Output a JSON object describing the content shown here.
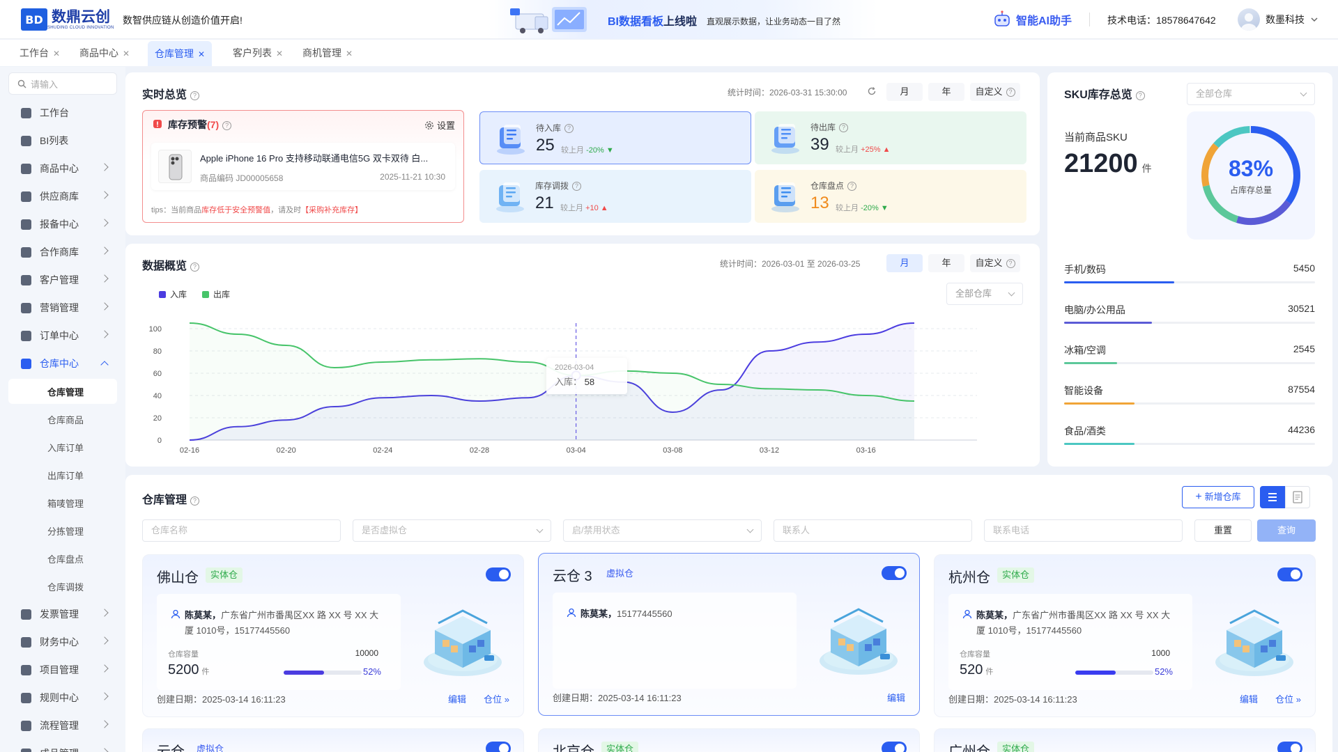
{
  "header": {
    "logo_mark": "BD",
    "logo_text": "数鼎云创",
    "logo_sub": "SHUDING CLOUD INNOVATION",
    "slogan": "数智供应链从创造价值开启!",
    "banner_title_a": "BI数据看板",
    "banner_title_b": "上线啦",
    "banner_desc": "直观展示数据，让业务动态一目了然",
    "ai_label": "智能AI助手",
    "phone": "技术电话：18578647642",
    "company": "数墨科技"
  },
  "tabs": [
    {
      "label": "工作台"
    },
    {
      "label": "商品中心"
    },
    {
      "label": "仓库管理",
      "active": true
    },
    {
      "label": "客户列表"
    },
    {
      "label": "商机管理"
    }
  ],
  "sidebar": {
    "search_placeholder": "请输入",
    "items": [
      {
        "label": "工作台",
        "chevron": false
      },
      {
        "label": "BI列表",
        "chevron": false
      },
      {
        "label": "商品中心",
        "chevron": true
      },
      {
        "label": "供应商库",
        "chevron": true
      },
      {
        "label": "报备中心",
        "chevron": true
      },
      {
        "label": "合作商库",
        "chevron": true
      },
      {
        "label": "客户管理",
        "chevron": true
      },
      {
        "label": "营销管理",
        "chevron": true
      },
      {
        "label": "订单中心",
        "chevron": true
      },
      {
        "label": "仓库中心",
        "chevron": true,
        "open": true
      }
    ],
    "subitems": [
      "仓库管理",
      "仓库商品",
      "入库订单",
      "出库订单",
      "箱唛管理",
      "分拣管理",
      "仓库盘点",
      "仓库调拨"
    ],
    "items_after": [
      {
        "label": "发票管理"
      },
      {
        "label": "财务中心"
      },
      {
        "label": "项目管理"
      },
      {
        "label": "规则中心"
      },
      {
        "label": "流程管理"
      },
      {
        "label": "成品管理"
      }
    ]
  },
  "realtime": {
    "title": "实时总览",
    "stat_time": "统计时间：2026-03-31 15:30:00",
    "periods": [
      "月",
      "年",
      "自定义"
    ],
    "warning": {
      "title": "库存预警",
      "count": "(7)",
      "settings": "设置",
      "product": "Apple iPhone 16 Pro 支持移动联通电信5G 双卡双待 白...",
      "code": "商品编码  JD00005658",
      "date": "2025-11-21  10:30",
      "tips_a": "tips：当前商品",
      "tips_b": "库存低于安全预警值",
      "tips_c": "，请及时",
      "tips_d": "【采购补充库存】"
    },
    "stats": [
      {
        "label": "待入库",
        "value": "25",
        "compare": "较上月",
        "change": "-20%",
        "dir": "down",
        "bg": "#e6eeff",
        "border": "#6b8df6",
        "accent": "#3d7bf5"
      },
      {
        "label": "待出库",
        "value": "39",
        "compare": "较上月",
        "change": "+25%",
        "dir": "up",
        "bg": "#e9f7ef",
        "border": "transparent",
        "accent": "#4e8ff7"
      },
      {
        "label": "库存调拨",
        "value": "21",
        "compare": "较上月",
        "change": "+10",
        "dir": "up",
        "bg": "#e8f3fd",
        "border": "transparent",
        "accent": "#5aa7f2"
      },
      {
        "label": "仓库盘点",
        "value": "13",
        "compare": "较上月",
        "change": "-20%",
        "dir": "down",
        "bg": "#fdf8e8",
        "border": "transparent",
        "accent": "#3d8ef0",
        "value_color": "#f08a1b"
      }
    ]
  },
  "sku": {
    "title": "SKU库存总览",
    "select": "全部仓库",
    "current_label": "当前商品SKU",
    "current_value": "21200",
    "unit": "件",
    "ring_pct": "83%",
    "ring_label": "占库存总量",
    "ring_value": 0.83,
    "categories": [
      {
        "name": "手机/数码",
        "value": "5450",
        "fill": 0.44,
        "color": "#2a5df0"
      },
      {
        "name": "电脑/办公用品",
        "value": "30521",
        "fill": 0.35,
        "color": "#5b5bd6"
      },
      {
        "name": "冰箱/空调",
        "value": "2545",
        "fill": 0.21,
        "color": "#5cc89a"
      },
      {
        "name": "智能设备",
        "value": "87554",
        "fill": 0.28,
        "color": "#f0a437"
      },
      {
        "name": "食品/酒类",
        "value": "44236",
        "fill": 0.28,
        "color": "#4cc7c2"
      }
    ]
  },
  "overview": {
    "title": "数据概览",
    "stat_time": "统计时间：2026-03-01 至 2026-03-25",
    "periods": [
      "月",
      "年",
      "自定义"
    ],
    "select": "全部仓库",
    "tooltip_date": "2026-03-04",
    "tooltip_label": "入库：",
    "tooltip_value": "58"
  },
  "chart_data": {
    "type": "line",
    "x": [
      "02-16",
      "02-18",
      "02-20",
      "02-22",
      "02-24",
      "02-26",
      "02-28",
      "03-02",
      "03-04",
      "03-06",
      "03-08",
      "03-10",
      "03-12",
      "03-14",
      "03-16",
      "03-17"
    ],
    "xticks": [
      "02-16",
      "02-20",
      "02-24",
      "02-28",
      "03-04",
      "03-08",
      "03-12",
      "03-16"
    ],
    "ylim": [
      0,
      100
    ],
    "yticks": [
      0,
      20,
      40,
      60,
      80,
      100
    ],
    "series": [
      {
        "name": "入库",
        "color": "#4b3ce0",
        "values": [
          0,
          12,
          18,
          30,
          38,
          40,
          35,
          38,
          58,
          52,
          25,
          45,
          80,
          88,
          95,
          105
        ]
      },
      {
        "name": "出库",
        "color": "#47c46a",
        "values": [
          105,
          95,
          85,
          65,
          70,
          72,
          73,
          70,
          58,
          62,
          60,
          50,
          46,
          45,
          40,
          35
        ]
      }
    ]
  },
  "warehouse": {
    "title": "仓库管理",
    "add_label": "新增仓库",
    "filters": [
      "仓库名称",
      "是否虚拟仓",
      "启/禁用状态",
      "联系人",
      "联系电话"
    ],
    "reset": "重置",
    "query": "查询",
    "cards": [
      {
        "name": "佛山仓",
        "tag": "实体仓",
        "type": "real",
        "contact": "陈莫某，",
        "address": "广东省广州市番禺区XX 路 XX 号 XX 大厦 1010号，15177445560",
        "cap_label": "仓库容量",
        "cap_total": "10000",
        "cap_used": "5200",
        "unit": "件",
        "pct": "52%",
        "pct_value": 0.52,
        "date": "创建日期：2025-03-14 16:11:23",
        "actions": [
          "编辑",
          "仓位"
        ]
      },
      {
        "name": "云仓 3",
        "tag": "虚拟仓",
        "type": "virt",
        "contact": "陈莫某，",
        "address": "15177445560",
        "date": "创建日期：2025-03-14 16:11:23",
        "actions": [
          "编辑"
        ],
        "selected": true
      },
      {
        "name": "杭州仓",
        "tag": "实体仓",
        "type": "real",
        "contact": "陈莫某，",
        "address": "广东省广州市番禺区XX 路 XX 号 XX 大厦 1010号，15177445560",
        "cap_label": "仓库容量",
        "cap_total": "1000",
        "cap_used": "520",
        "unit": "件",
        "pct": "52%",
        "pct_value": 0.52,
        "date": "创建日期：2025-03-14 16:11:23",
        "actions": [
          "编辑",
          "仓位"
        ]
      },
      {
        "name": "云仓",
        "tag": "虚拟仓",
        "type": "virt"
      },
      {
        "name": "北京仓",
        "tag": "实体仓",
        "type": "real"
      },
      {
        "name": "广州仓",
        "tag": "实体仓",
        "type": "real"
      }
    ]
  }
}
